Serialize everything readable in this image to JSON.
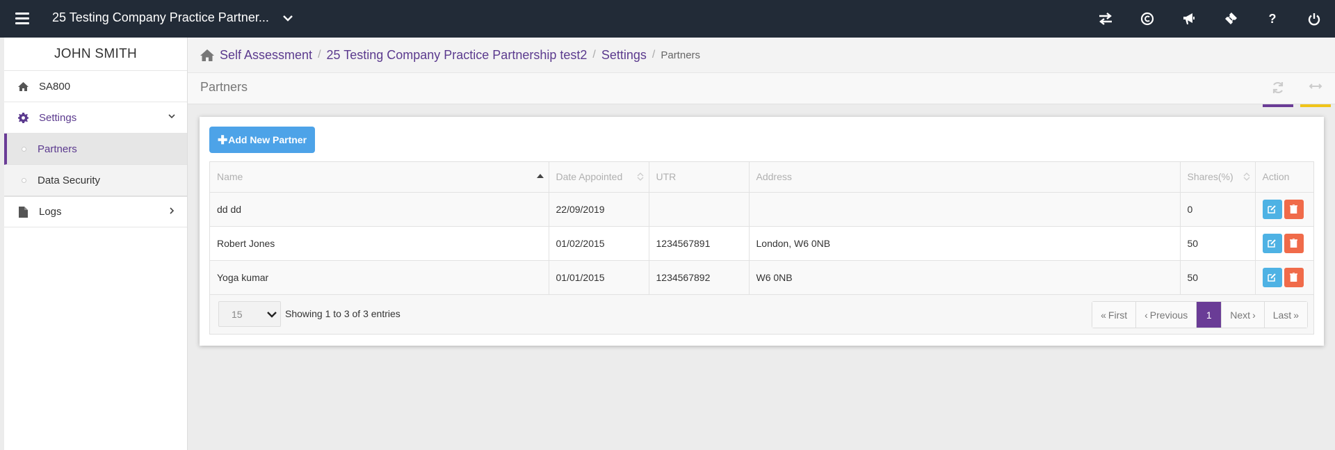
{
  "topbar": {
    "company": "25 Testing Company Practice Partner...",
    "icons": [
      "transfer-icon",
      "copyright-icon",
      "bullhorn-icon",
      "ticket-icon",
      "help-icon",
      "power-icon"
    ],
    "help_glyph": "?"
  },
  "sidebar": {
    "user": "JOHN SMITH",
    "items": [
      {
        "label": "SA800",
        "icon": "home-icon"
      },
      {
        "label": "Settings",
        "icon": "gear-icon"
      },
      {
        "label": "Partners"
      },
      {
        "label": "Data Security"
      },
      {
        "label": "Logs",
        "icon": "file-icon"
      }
    ]
  },
  "breadcrumb": {
    "items": [
      "Self Assessment",
      "25 Testing Company Practice Partnership test2",
      "Settings"
    ],
    "separator": "/",
    "current": "Partners"
  },
  "page": {
    "title": "Partners",
    "accent_purple": "#6a3c96",
    "accent_yellow": "#f0c419"
  },
  "table": {
    "add_button": "Add New Partner",
    "columns": [
      "Name",
      "Date Appointed",
      "UTR",
      "Address",
      "Shares(%)",
      "Action"
    ],
    "rows": [
      {
        "name": "dd dd",
        "date": "22/09/2019",
        "utr": "",
        "address": "",
        "shares": "0"
      },
      {
        "name": "Robert Jones",
        "date": "01/02/2015",
        "utr": "1234567891",
        "address": "London, W6 0NB",
        "shares": "50"
      },
      {
        "name": "Yoga kumar",
        "date": "01/01/2015",
        "utr": "1234567892",
        "address": "W6 0NB",
        "shares": "50"
      }
    ],
    "page_size": "15",
    "showing": "Showing 1 to 3 of 3 entries",
    "pager": {
      "first": "First",
      "previous": "Previous",
      "current": "1",
      "next": "Next",
      "last": "Last"
    }
  }
}
